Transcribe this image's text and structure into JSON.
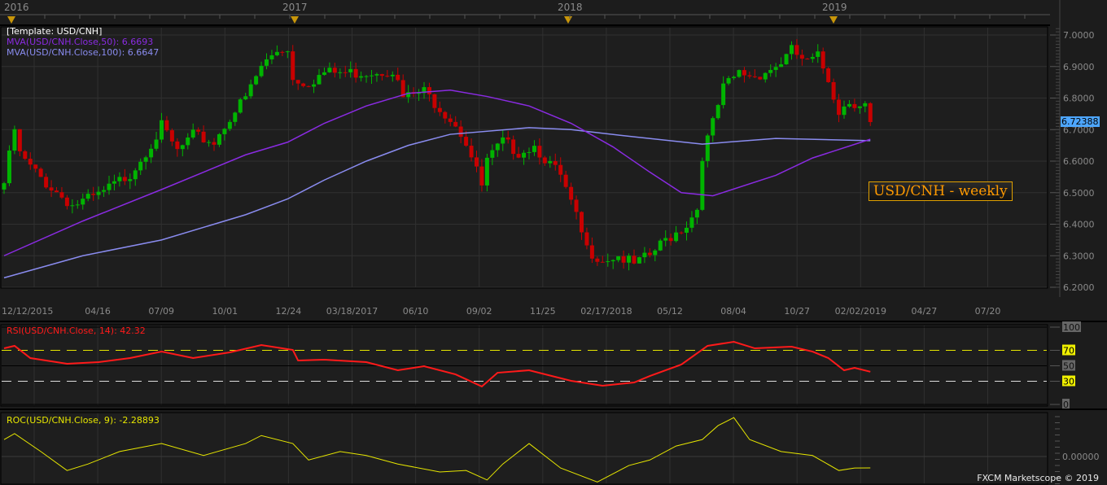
{
  "header": {
    "years": [
      "2016",
      "2017",
      "2018",
      "2019"
    ],
    "template_label": "[Template: USD/CNH]",
    "mva50_label": "MVA(USD/CNH.Close,50): 6.6693",
    "mva100_label": "MVA(USD/CNH.Close,100): 6.6647",
    "chart_title": "USD/CNH - weekly",
    "current_price": "6.72388"
  },
  "rsi": {
    "label": "RSI(USD/CNH.Close, 14): 42.32",
    "ticks": [
      "100",
      "70",
      "50",
      "30",
      "0"
    ]
  },
  "roc": {
    "label": "ROC(USD/CNH.Close, 9): -2.28893",
    "ticks": [
      "0.00000"
    ]
  },
  "footer": {
    "copyright": "FXCM Marketscope © 2019"
  },
  "colors": {
    "up": "#00b400",
    "down": "#c80000",
    "mva50": "#8a2be2",
    "mva100": "#8a8cf0",
    "rsi": "#ff1a1a",
    "roc": "#e6e600",
    "price_badge": "#4da6ff"
  },
  "chart_data": [
    {
      "type": "candlestick",
      "title": "USD/CNH - weekly",
      "x_unit": "week index from 12/12/2015",
      "x_tick_labels": [
        "12/12/2015",
        "04/16",
        "07/09",
        "10/01",
        "12/24",
        "03/18/2017",
        "06/10",
        "09/02",
        "11/25",
        "02/17/2018",
        "05/12",
        "08/04",
        "10/27",
        "02/02/2019",
        "04/27",
        "07/20"
      ],
      "y_tick_labels": [
        "7.0000",
        "6.9000",
        "6.8000",
        "6.7000",
        "6.6000",
        "6.5000",
        "6.4000",
        "6.3000",
        "6.2000"
      ],
      "ylim": [
        6.2,
        7.02
      ],
      "close_path": [
        [
          0,
          6.53
        ],
        [
          2,
          6.7
        ],
        [
          3,
          6.62
        ],
        [
          5,
          6.58
        ],
        [
          8,
          6.53
        ],
        [
          13,
          6.46
        ],
        [
          18,
          6.49
        ],
        [
          24,
          6.56
        ],
        [
          29,
          6.68
        ],
        [
          30,
          6.71
        ],
        [
          33,
          6.63
        ],
        [
          36,
          6.68
        ],
        [
          40,
          6.66
        ],
        [
          43,
          6.74
        ],
        [
          46,
          6.8
        ],
        [
          49,
          6.9
        ],
        [
          52,
          6.95
        ],
        [
          54,
          6.96
        ],
        [
          55,
          6.86
        ],
        [
          58,
          6.85
        ],
        [
          61,
          6.88
        ],
        [
          67,
          6.88
        ],
        [
          74,
          6.89
        ],
        [
          76,
          6.8
        ],
        [
          80,
          6.82
        ],
        [
          83,
          6.77
        ],
        [
          86,
          6.72
        ],
        [
          88,
          6.66
        ],
        [
          91,
          6.52
        ],
        [
          92,
          6.6
        ],
        [
          95,
          6.66
        ],
        [
          98,
          6.63
        ],
        [
          101,
          6.65
        ],
        [
          103,
          6.61
        ],
        [
          106,
          6.55
        ],
        [
          109,
          6.42
        ],
        [
          111,
          6.32
        ],
        [
          114,
          6.29
        ],
        [
          117,
          6.3
        ],
        [
          120,
          6.27
        ],
        [
          123,
          6.3
        ],
        [
          126,
          6.35
        ],
        [
          130,
          6.4
        ],
        [
          132,
          6.45
        ],
        [
          133,
          6.62
        ],
        [
          135,
          6.72
        ],
        [
          137,
          6.83
        ],
        [
          140,
          6.88
        ],
        [
          143,
          6.87
        ],
        [
          147,
          6.9
        ],
        [
          149,
          6.93
        ],
        [
          150,
          6.95
        ],
        [
          153,
          6.91
        ],
        [
          155,
          6.93
        ],
        [
          157,
          6.86
        ],
        [
          159,
          6.76
        ],
        [
          161,
          6.79
        ],
        [
          164,
          6.78
        ],
        [
          165,
          6.72388
        ]
      ],
      "series": [
        {
          "name": "MVA(USD/CNH.Close,50)",
          "points": [
            [
              0,
              6.3
            ],
            [
              15,
              6.41
            ],
            [
              30,
              6.51
            ],
            [
              46,
              6.62
            ],
            [
              54,
              6.66
            ],
            [
              61,
              6.72
            ],
            [
              69,
              6.775
            ],
            [
              77,
              6.815
            ],
            [
              85,
              6.825
            ],
            [
              92,
              6.805
            ],
            [
              100,
              6.775
            ],
            [
              108,
              6.72
            ],
            [
              116,
              6.645
            ],
            [
              123,
              6.565
            ],
            [
              129,
              6.5
            ],
            [
              135,
              6.49
            ],
            [
              147,
              6.555
            ],
            [
              154,
              6.61
            ],
            [
              165,
              6.6693
            ]
          ]
        },
        {
          "name": "MVA(USD/CNH.Close,100)",
          "points": [
            [
              0,
              6.23
            ],
            [
              15,
              6.3
            ],
            [
              30,
              6.35
            ],
            [
              46,
              6.43
            ],
            [
              54,
              6.48
            ],
            [
              61,
              6.54
            ],
            [
              69,
              6.6
            ],
            [
              77,
              6.65
            ],
            [
              85,
              6.685
            ],
            [
              100,
              6.706
            ],
            [
              108,
              6.7
            ],
            [
              120,
              6.677
            ],
            [
              133,
              6.654
            ],
            [
              147,
              6.672
            ],
            [
              165,
              6.6647
            ]
          ]
        }
      ]
    },
    {
      "type": "line",
      "title": "RSI(USD/CNH.Close, 14)",
      "ylim": [
        0,
        100
      ],
      "levels": [
        70,
        30
      ],
      "points": [
        [
          0,
          72.6
        ],
        [
          2,
          75.8
        ],
        [
          5,
          60
        ],
        [
          12,
          52.6
        ],
        [
          18,
          54.7
        ],
        [
          24,
          60
        ],
        [
          30,
          68.4
        ],
        [
          36,
          60
        ],
        [
          43,
          67.4
        ],
        [
          49,
          76.8
        ],
        [
          55,
          70.5
        ],
        [
          56,
          56.8
        ],
        [
          61,
          57.9
        ],
        [
          69,
          54.7
        ],
        [
          75,
          44.2
        ],
        [
          80,
          49.5
        ],
        [
          86,
          38.9
        ],
        [
          91,
          23.2
        ],
        [
          94,
          41
        ],
        [
          100,
          44.2
        ],
        [
          108,
          30.5
        ],
        [
          114,
          24.2
        ],
        [
          120,
          28.4
        ],
        [
          123,
          36.8
        ],
        [
          129,
          51.6
        ],
        [
          134,
          75.8
        ],
        [
          139,
          81
        ],
        [
          143,
          72.6
        ],
        [
          150,
          74.7
        ],
        [
          154,
          68.4
        ],
        [
          157,
          60
        ],
        [
          160,
          44.2
        ],
        [
          162,
          47.4
        ],
        [
          165,
          42.32
        ]
      ]
    },
    {
      "type": "line",
      "title": "ROC(USD/CNH.Close, 9)",
      "ylim": [
        -5.2,
        10.5
      ],
      "points": [
        [
          0,
          3.4
        ],
        [
          2,
          4.6
        ],
        [
          7,
          1.0
        ],
        [
          12,
          -2.8
        ],
        [
          16,
          -1.5
        ],
        [
          22,
          1.0
        ],
        [
          30,
          2.6
        ],
        [
          38,
          0.2
        ],
        [
          46,
          2.6
        ],
        [
          49,
          4.2
        ],
        [
          55,
          2.6
        ],
        [
          58,
          -0.7
        ],
        [
          64,
          1.0
        ],
        [
          69,
          0.2
        ],
        [
          75,
          -1.5
        ],
        [
          83,
          -3.1
        ],
        [
          88,
          -2.8
        ],
        [
          92,
          -4.7
        ],
        [
          95,
          -1.5
        ],
        [
          100,
          2.6
        ],
        [
          106,
          -2.3
        ],
        [
          113,
          -5.1
        ],
        [
          119,
          -1.8
        ],
        [
          123,
          -0.7
        ],
        [
          128,
          2.1
        ],
        [
          133,
          3.4
        ],
        [
          136,
          6.2
        ],
        [
          139,
          7.8
        ],
        [
          142,
          3.4
        ],
        [
          148,
          1.0
        ],
        [
          154,
          0.2
        ],
        [
          159,
          -2.8
        ],
        [
          162,
          -2.3
        ],
        [
          165,
          -2.28893
        ]
      ]
    }
  ]
}
